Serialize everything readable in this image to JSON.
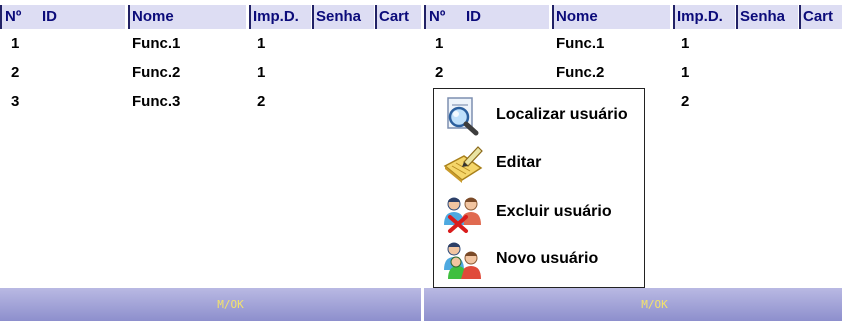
{
  "columns": {
    "no": "Nº",
    "id": "ID",
    "nome": "Nome",
    "imp": "Imp.D.",
    "senha": "Senha",
    "cart": "Cart"
  },
  "left_rows": [
    {
      "no": "1",
      "nome": "Func.1",
      "imp": "1"
    },
    {
      "no": "2",
      "nome": "Func.2",
      "imp": "1"
    },
    {
      "no": "3",
      "nome": "Func.3",
      "imp": "2"
    }
  ],
  "right_rows": [
    {
      "no": "1",
      "nome": "Func.1",
      "imp": "1"
    },
    {
      "no": "2",
      "nome": "Func.2",
      "imp": "1"
    },
    {
      "no": "",
      "nome": "",
      "imp": "2"
    }
  ],
  "status": {
    "text": "M/OK"
  },
  "menu": {
    "items": [
      {
        "label": "Localizar usuário",
        "icon": "search-user-icon"
      },
      {
        "label": "Editar",
        "icon": "edit-icon"
      },
      {
        "label": "Excluir usuário",
        "icon": "delete-user-icon"
      },
      {
        "label": "Novo usuário",
        "icon": "new-user-icon"
      }
    ]
  }
}
